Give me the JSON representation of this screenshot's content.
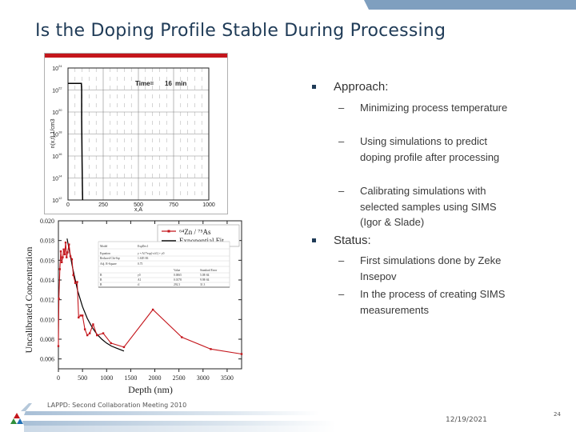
{
  "slide": {
    "title": "Is the Doping Profile Stable During Processing",
    "footer": "LAPPD: Second Collaboration Meeting 2010",
    "date": "12/19/2021",
    "page_number": "24",
    "accent_color": "#7f9fbf",
    "title_color": "#1f3b57"
  },
  "bullets": [
    {
      "label": "Approach:",
      "subitems": [
        "Minimizing process temperature",
        "Using simulations to predict doping profile after processing",
        "Calibrating simulations with selected samples using SIMS (Igor & Slade)"
      ]
    },
    {
      "label": "Status:",
      "subitems": [
        "First simulations done by Zeke Insepov",
        "In the process of creating SIMS measurements"
      ]
    }
  ],
  "chart_data": [
    {
      "type": "line",
      "title": "",
      "header_bar_color": "#c4161c",
      "annotation": {
        "label": "Time=",
        "value": "16",
        "unit": "min"
      },
      "xlabel": "x,A",
      "ylabel": "n(x,t),1/cm3",
      "xlim": [
        0,
        1000
      ],
      "ylim_log10": [
        12,
        24
      ],
      "x_ticks": [
        "0",
        "250",
        "500",
        "750",
        "1000"
      ],
      "y_ticks": [
        {
          "base": "10",
          "exp": "24"
        },
        {
          "base": "10",
          "exp": "22"
        },
        {
          "base": "10",
          "exp": "20"
        },
        {
          "base": "10",
          "exp": "18"
        },
        {
          "base": "10",
          "exp": "16"
        },
        {
          "base": "10",
          "exp": "14"
        },
        {
          "base": "10",
          "exp": "12"
        }
      ],
      "grid": true,
      "series": [
        {
          "name": "profile",
          "color": "#000000",
          "x": [
            0,
            95,
            97,
            97,
            100,
            102,
            104
          ],
          "log10_y": [
            22.6,
            22.6,
            22.0,
            19.5,
            15.5,
            13.4,
            12.0
          ]
        }
      ]
    },
    {
      "type": "line",
      "title": "",
      "xlabel": "Depth (nm)",
      "ylabel": "Uncalibrated Concentration",
      "xlim": [
        0,
        3800
      ],
      "ylim": [
        0.005,
        0.02
      ],
      "x_ticks": [
        "0",
        "500",
        "1000",
        "1500",
        "2000",
        "2500",
        "3000",
        "3500"
      ],
      "y_ticks": [
        "0.020",
        "0.018",
        "0.016",
        "0.014",
        "0.012",
        "0.010",
        "0.008",
        "0.006"
      ],
      "grid": false,
      "legend_position": "top-right",
      "legend": [
        {
          "label": "⁶⁴Zn / ⁷⁵As",
          "color": "#c4161c",
          "marker": true
        },
        {
          "label": "Exponential Fit",
          "color": "#000000",
          "marker": false
        }
      ],
      "series": [
        {
          "name": "64Zn/75As",
          "color": "#c4161c",
          "x": [
            0,
            10,
            30,
            50,
            70,
            90,
            110,
            130,
            150,
            170,
            190,
            220,
            250,
            280,
            310,
            350,
            390,
            420,
            460,
            500,
            550,
            600,
            650,
            720,
            800,
            930,
            1090,
            1360,
            1960,
            2560,
            3160,
            3800
          ],
          "y": [
            0.0073,
            0.0121,
            0.0151,
            0.0169,
            0.0158,
            0.0163,
            0.0171,
            0.0166,
            0.0178,
            0.0163,
            0.0168,
            0.0176,
            0.0164,
            0.0161,
            0.0145,
            0.0137,
            0.0138,
            0.0102,
            0.0104,
            0.0104,
            0.009,
            0.0084,
            0.0086,
            0.0095,
            0.0084,
            0.0086,
            0.0076,
            0.0072,
            0.011,
            0.0082,
            0.007,
            0.0065
          ]
        },
        {
          "name": "Exponential Fit",
          "color": "#000000",
          "x": [
            180,
            300,
            400,
            500,
            600,
            700,
            800,
            900,
            1000,
            1100,
            1200,
            1360
          ],
          "y": [
            0.0182,
            0.0151,
            0.0129,
            0.0113,
            0.0101,
            0.0092,
            0.0085,
            0.008,
            0.0076,
            0.0073,
            0.0071,
            0.0068
          ]
        }
      ],
      "inset_table": {
        "rows": [
          [
            "Model",
            "ExpDec1",
            "",
            ""
          ],
          [
            "Equation",
            "y = A1*exp(-x/t1) + y0",
            "",
            ""
          ],
          [
            "Reduced Chi-Sqr",
            "1.61E-06",
            "",
            ""
          ],
          [
            "Adj. R-Square",
            "0.75",
            "",
            ""
          ],
          [
            "",
            "",
            "Value",
            "Standard Error"
          ],
          [
            "B",
            "y0",
            "0.0065",
            "5.0E-04"
          ],
          [
            "B",
            "A1",
            "0.0178",
            "9.9E-04"
          ],
          [
            "B",
            "t1",
            "292.3",
            "31.3"
          ]
        ]
      }
    }
  ]
}
